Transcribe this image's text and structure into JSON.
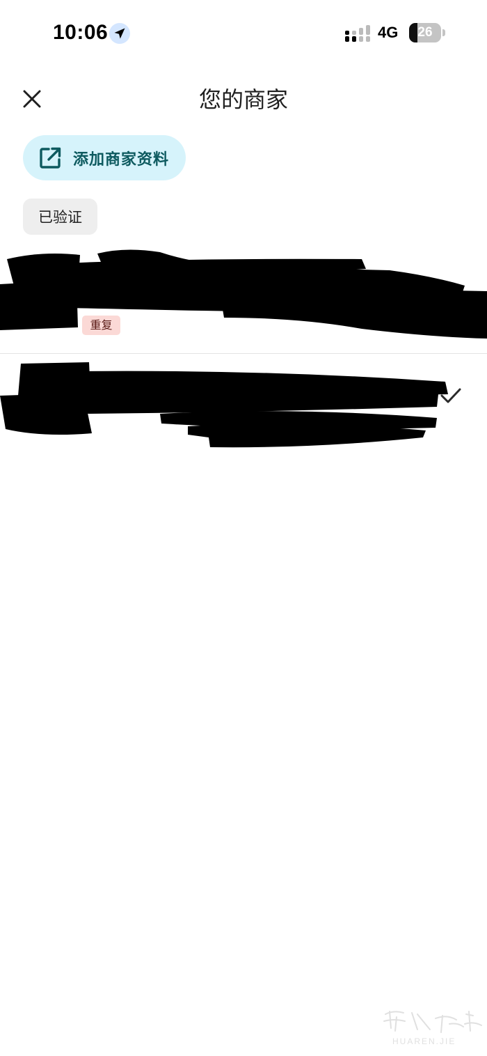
{
  "status_bar": {
    "time": "10:06",
    "network": "4G",
    "battery_level": "26",
    "battery_fraction": 0.26,
    "icons": [
      "location-arrow-icon",
      "signal-bars-icon",
      "battery-icon"
    ]
  },
  "header": {
    "title": "您的商家",
    "close_icon": "close-icon"
  },
  "actions": {
    "add_profile_label": "添加商家资料",
    "add_profile_icon": "open-external-icon"
  },
  "filter": {
    "verified_label": "已验证"
  },
  "businesses": [
    {
      "name": "",
      "badge": "重复",
      "selected": false
    },
    {
      "name": "",
      "badge": "",
      "selected": true
    }
  ],
  "watermark": {
    "text": "HUAREN.JIE"
  },
  "colors": {
    "pill_bg": "#d6f3fb",
    "pill_text": "#0d5a5f",
    "badge_bg": "#fbd9d6",
    "chip_bg": "#eeeeee"
  }
}
